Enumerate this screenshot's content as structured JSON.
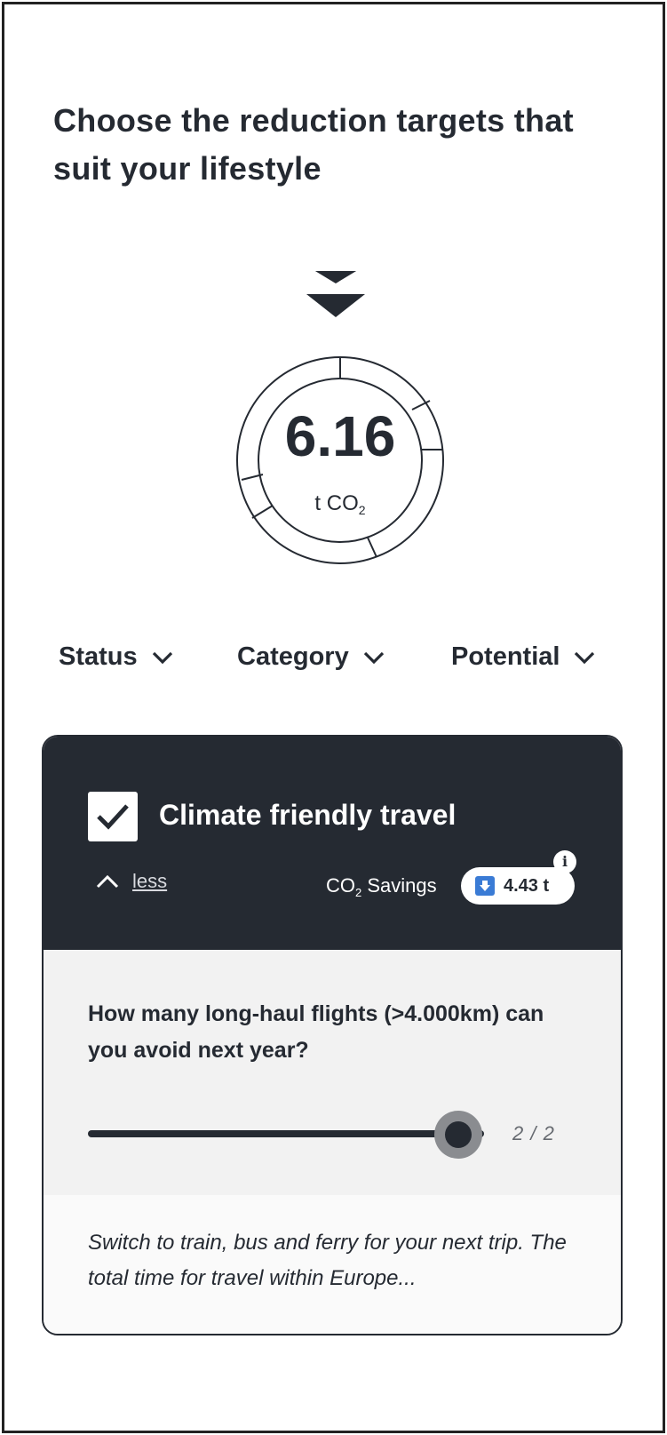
{
  "headline": "Choose the reduction targets that suit your lifestyle",
  "gauge": {
    "value": "6.16",
    "unit_prefix": "t CO",
    "unit_subscript": "2"
  },
  "filters": [
    {
      "label": "Status"
    },
    {
      "label": "Category"
    },
    {
      "label": "Potential"
    }
  ],
  "card": {
    "title": "Climate friendly travel",
    "checked": true,
    "toggle_label": "less",
    "savings_label_prefix": "CO",
    "savings_label_subscript": "2",
    "savings_label_suffix": " Savings",
    "savings_value": "4.43 t",
    "info_glyph": "i",
    "question": "How many long-haul flights (>4.000km) can you avoid next year?",
    "slider": {
      "value": 2,
      "max": 2,
      "count_text": "2 / 2"
    },
    "description": "Switch to train, bus and ferry for your next trip. The total time for travel within Europe..."
  },
  "colors": {
    "dark": "#252a32",
    "light_bg": "#f2f2f2",
    "badge_blue": "#3a7bd5"
  },
  "icons": {
    "arrows": "double-chevron-down-icon",
    "filter_chevron": "chevron-down-icon",
    "toggle": "chevron-up-icon",
    "checkbox": "checkmark-icon",
    "savings_badge": "arrow-down-icon",
    "info": "info-icon"
  }
}
